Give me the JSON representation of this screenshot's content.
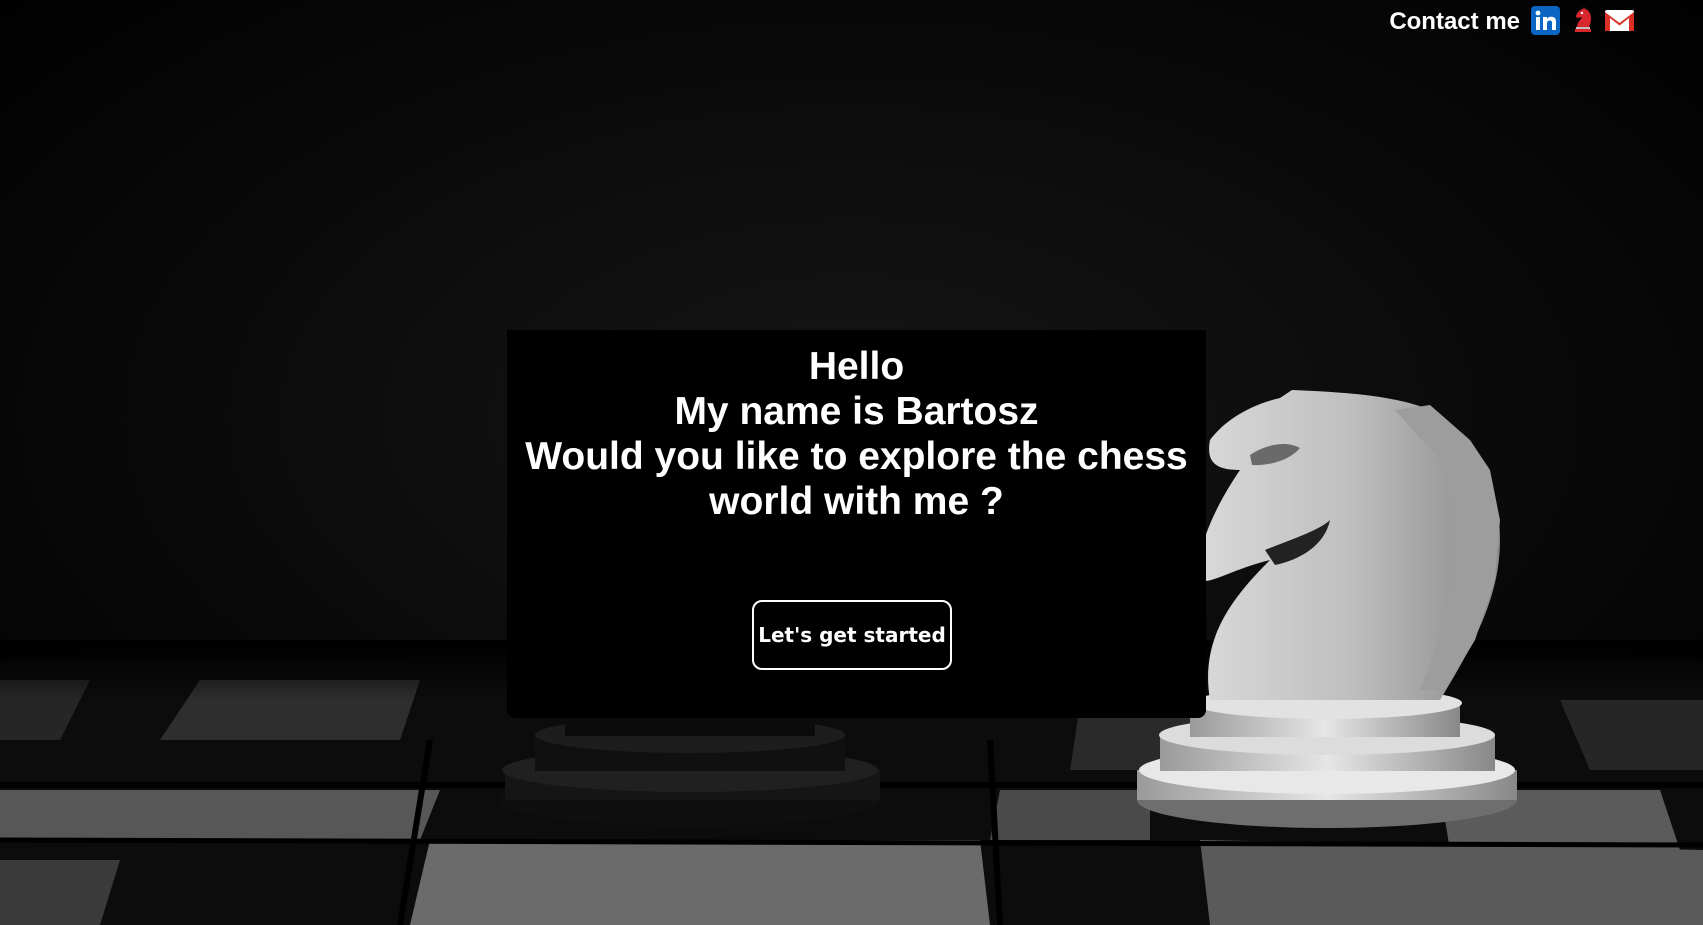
{
  "contact": {
    "label": "Contact me",
    "links": [
      {
        "icon": "linkedin-icon",
        "color": "#0a66c2"
      },
      {
        "icon": "chess-knight-icon",
        "color": "#d8282d"
      },
      {
        "icon": "gmail-icon",
        "color": "#d93025"
      }
    ]
  },
  "hero": {
    "line1": "Hello",
    "line2": "My name is Bartosz",
    "line3": "Would you like to explore the chess",
    "line4": "world with me ?",
    "cta_label": "Let's get started"
  },
  "colors": {
    "background": "#000000",
    "text": "#ffffff"
  }
}
